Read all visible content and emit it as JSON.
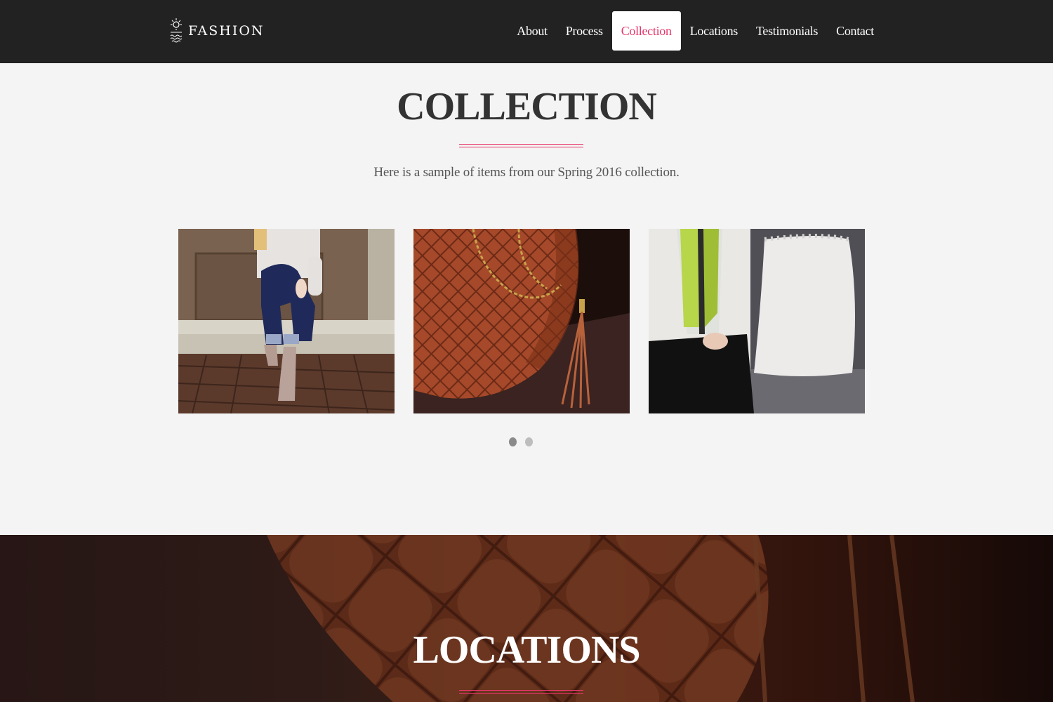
{
  "brand": {
    "name": "FASHION",
    "logo_icon": "sun-waves-icon"
  },
  "nav": {
    "items": [
      {
        "label": "About"
      },
      {
        "label": "Process"
      },
      {
        "label": "Collection",
        "active": true
      },
      {
        "label": "Locations"
      },
      {
        "label": "Testimonials"
      },
      {
        "label": "Contact"
      }
    ]
  },
  "collection": {
    "title": "COLLECTION",
    "subtitle": "Here is a sample of items from our Spring 2016 collection.",
    "photos": [
      {
        "subject": "woman-sitting-jeans-boots-photo"
      },
      {
        "subject": "quilted-leather-handbag-photo"
      },
      {
        "subject": "woman-green-scarf-sofa-photo"
      }
    ],
    "carousel": {
      "pages": 2,
      "current": 1
    }
  },
  "locations": {
    "title": "LOCATIONS"
  },
  "colors": {
    "accent": "#e7356a",
    "navbar": "#222222",
    "section_bg": "#f4f4f4",
    "text_dark": "#333333"
  }
}
